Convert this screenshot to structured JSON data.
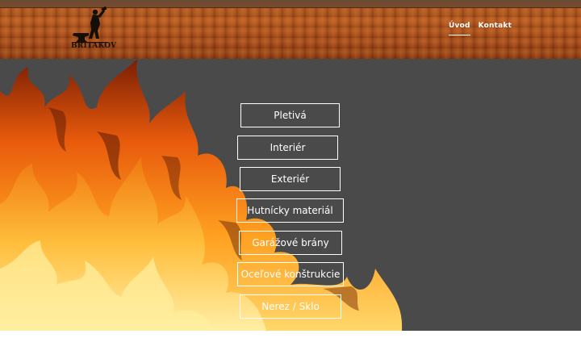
{
  "brand": {
    "logo_text": "BRITAKOV"
  },
  "nav": {
    "items": [
      {
        "label": "Úvod",
        "active": true
      },
      {
        "label": "Kontakt",
        "active": false
      }
    ]
  },
  "menu": {
    "buttons": [
      {
        "label": "Pletivá"
      },
      {
        "label": "Interiér"
      },
      {
        "label": "Exteriér"
      },
      {
        "label": "Hutnícky materiál"
      },
      {
        "label": "Garážové brány"
      },
      {
        "label": "Oceľové konštrukcie"
      },
      {
        "label": "Nerez / Sklo"
      }
    ]
  },
  "colors": {
    "hero_background": "#4a4a4a",
    "nav_text": "#ffffff",
    "button_border": "#ffffff"
  }
}
